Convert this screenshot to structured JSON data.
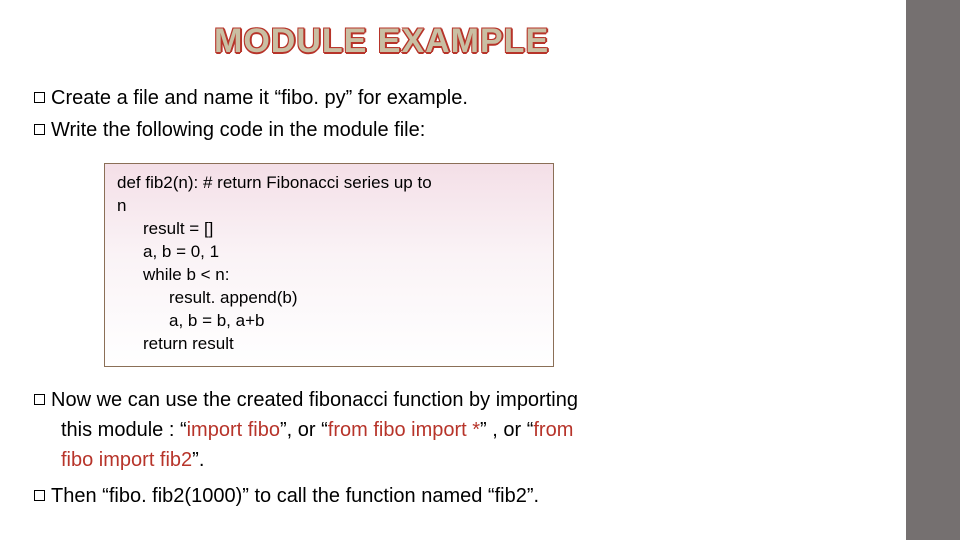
{
  "title": "MODULE EXAMPLE",
  "b1": {
    "l1a": "Create ",
    "l1b": "a file and name it “fibo. py” for example.",
    "l2a": "Write ",
    "l2b": "the following code in the module file:"
  },
  "code": {
    "l1": "def fib2(n): # return Fibonacci series up to",
    "l2": "n",
    "l3": "result = []",
    "l4": "a, b = 0, 1",
    "l5": "while b < n:",
    "l6": "result. append(b)",
    "l7": "a, b = b, a+b",
    "l8": "return result"
  },
  "b2": {
    "p1a": "Now ",
    "p1b": "we can use the created fibonacci function by importing",
    "p1c": "this module : “",
    "p1d": "import fibo",
    "p1e": "”, or “",
    "p1f": "from fibo import *",
    "p1g": "” , or “",
    "p1h": "from",
    "p1i": "fibo import fib2",
    "p1j": "”.",
    "p2a": "Then ",
    "p2b": "“fibo. fib2(1000)” to call the function named “fib2”."
  }
}
